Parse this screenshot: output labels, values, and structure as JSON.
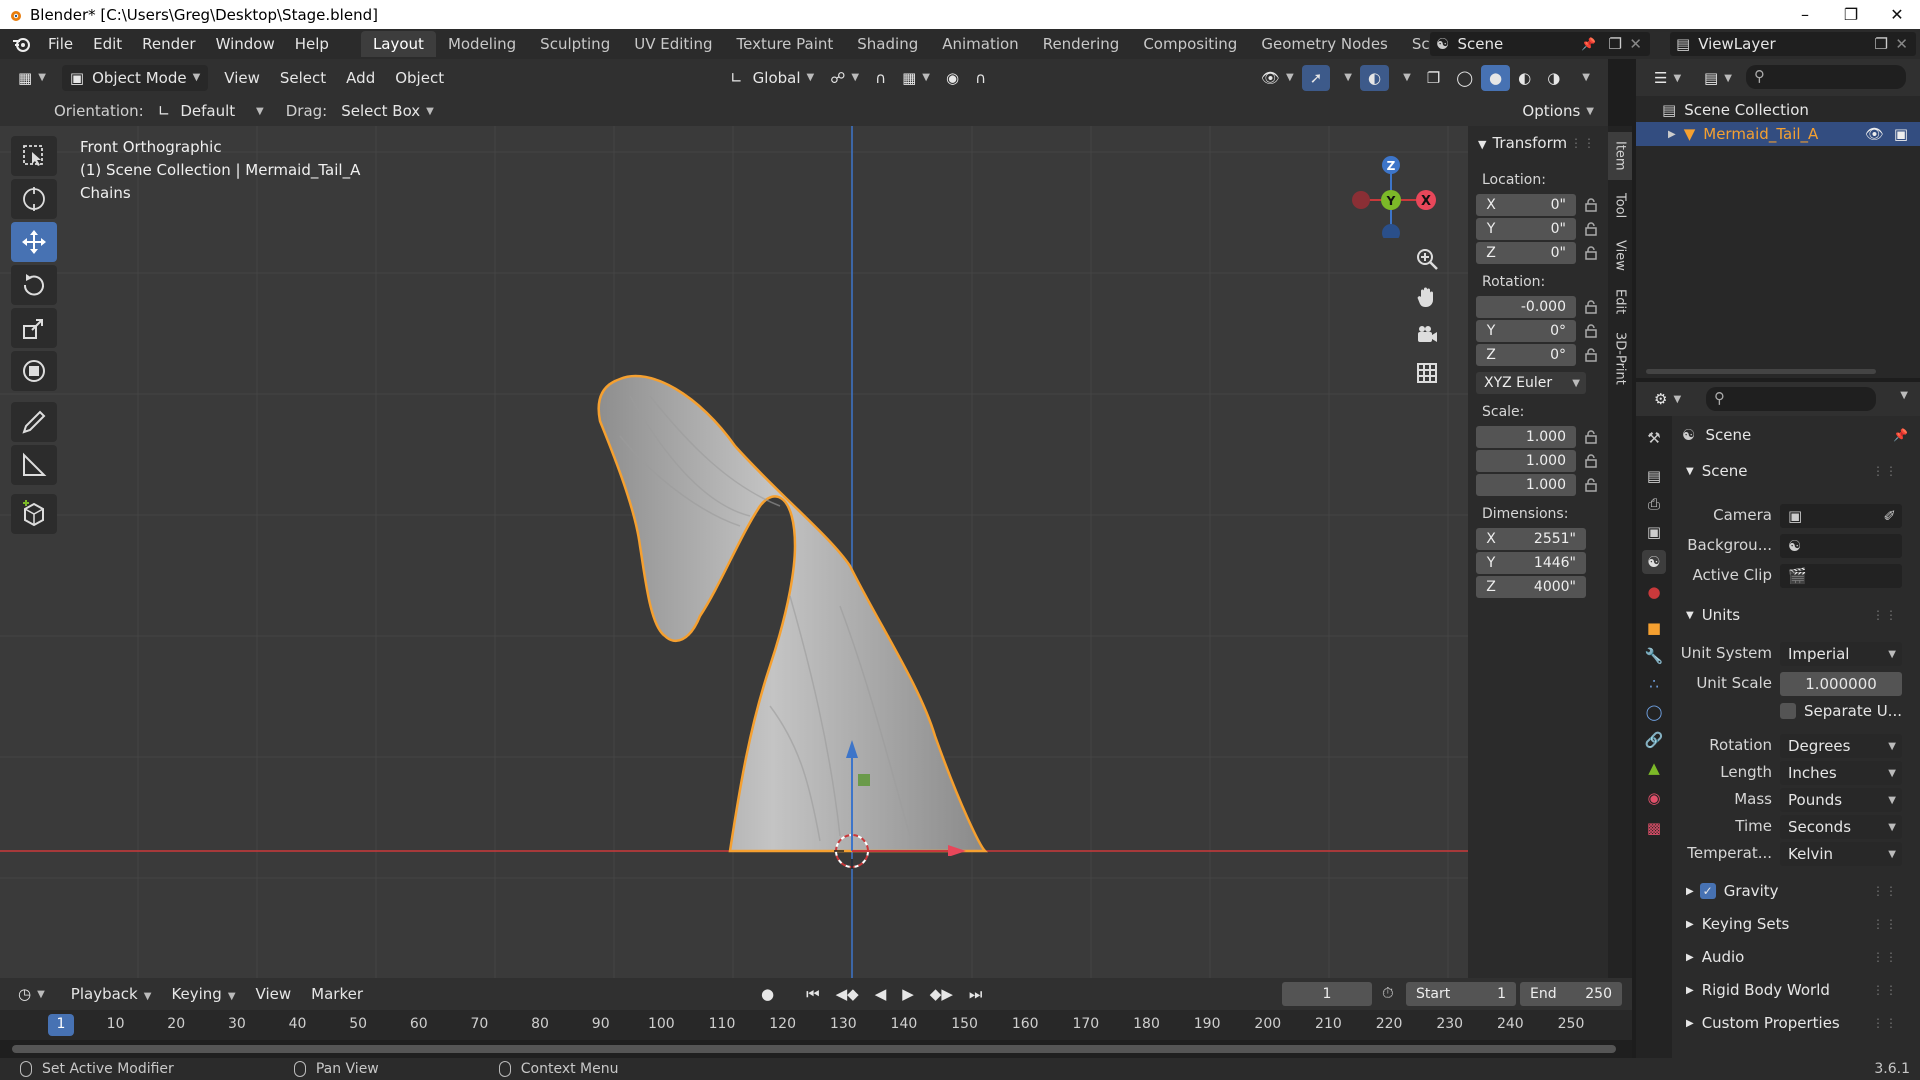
{
  "titlebar": {
    "title": "Blender* [C:\\Users\\Greg\\Desktop\\Stage.blend]"
  },
  "menu": [
    "File",
    "Edit",
    "Render",
    "Window",
    "Help"
  ],
  "workspaces": [
    {
      "label": "Layout",
      "active": true
    },
    {
      "label": "Modeling"
    },
    {
      "label": "Sculpting"
    },
    {
      "label": "UV Editing"
    },
    {
      "label": "Texture Paint"
    },
    {
      "label": "Shading"
    },
    {
      "label": "Animation"
    },
    {
      "label": "Rendering"
    },
    {
      "label": "Compositing"
    },
    {
      "label": "Geometry Nodes"
    },
    {
      "label": "Scripting"
    }
  ],
  "scene_selector": "Scene",
  "view_layer": "ViewLayer",
  "viewport_header": {
    "mode": "Object Mode",
    "menus": [
      "View",
      "Select",
      "Add",
      "Object"
    ],
    "transform_orientation": "Global",
    "orientation_label": "Orientation:",
    "orientation_value": "Default",
    "drag_label": "Drag:",
    "drag_value": "Select Box",
    "options": "Options"
  },
  "viewport_overlay": {
    "view_name": "Front Orthographic",
    "collection_info": "(1) Scene Collection | Mermaid_Tail_A",
    "extra": "Chains"
  },
  "npanel": {
    "tabs": [
      "Item",
      "Tool",
      "View",
      "Edit",
      "3D-Print"
    ],
    "section": "Transform",
    "location_label": "Location:",
    "location": [
      {
        "axis": "X",
        "value": "0\""
      },
      {
        "axis": "Y",
        "value": "0\""
      },
      {
        "axis": "Z",
        "value": "0\""
      }
    ],
    "rotation_label": "Rotation:",
    "rotation": [
      {
        "axis": "",
        "value": "-0.000"
      },
      {
        "axis": "Y",
        "value": "0°"
      },
      {
        "axis": "Z",
        "value": "0°"
      }
    ],
    "rotation_mode": "XYZ Euler",
    "scale_label": "Scale:",
    "scale": [
      "1.000",
      "1.000",
      "1.000"
    ],
    "dimensions_label": "Dimensions:",
    "dimensions": [
      {
        "axis": "X",
        "value": "2551\""
      },
      {
        "axis": "Y",
        "value": "1446\""
      },
      {
        "axis": "Z",
        "value": "4000\""
      }
    ]
  },
  "timeline": {
    "menus": [
      "Playback",
      "Keying",
      "View",
      "Marker"
    ],
    "current_frame": "1",
    "start_label": "Start",
    "start": "1",
    "end_label": "End",
    "end": "250",
    "ticks": [
      "1",
      "10",
      "20",
      "30",
      "40",
      "50",
      "60",
      "70",
      "80",
      "90",
      "100",
      "110",
      "120",
      "130",
      "140",
      "150",
      "160",
      "170",
      "180",
      "190",
      "200",
      "210",
      "220",
      "230",
      "240",
      "250"
    ]
  },
  "statusbar": {
    "items": [
      "Set Active Modifier",
      "Pan View",
      "Context Menu"
    ],
    "version": "3.6.1"
  },
  "outliner": {
    "root": "Scene Collection",
    "object": "Mermaid_Tail_A"
  },
  "properties": {
    "context": "Scene",
    "scene_section": "Scene",
    "camera_label": "Camera",
    "background_label": "Backgrou...",
    "active_clip_label": "Active Clip",
    "units_section": "Units",
    "unit_system_label": "Unit System",
    "unit_system": "Imperial",
    "unit_scale_label": "Unit Scale",
    "unit_scale": "1.000000",
    "separate_units": "Separate U...",
    "rotation_label": "Rotation",
    "rotation": "Degrees",
    "length_label": "Length",
    "length": "Inches",
    "mass_label": "Mass",
    "mass": "Pounds",
    "time_label": "Time",
    "time": "Seconds",
    "temperature_label": "Temperat...",
    "temperature": "Kelvin",
    "gravity": "Gravity",
    "gravity_checked": true,
    "keying_sets": "Keying Sets",
    "audio": "Audio",
    "rigid_body_world": "Rigid Body World",
    "custom_properties": "Custom Properties"
  },
  "colors": {
    "accent": "#4772b3",
    "selection_outline": "#f5a030",
    "x_axis": "#c9393b",
    "y_axis": "#7cb928",
    "z_axis": "#3d75c9"
  }
}
